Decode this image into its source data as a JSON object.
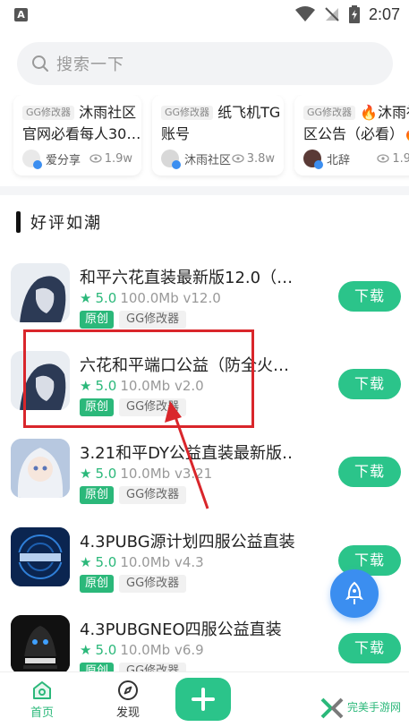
{
  "status_bar": {
    "time": "2:07",
    "app_indicator": "A"
  },
  "search": {
    "placeholder": "搜索一下"
  },
  "cards": [
    {
      "tag": "GG修改器",
      "title": "沐雨社区",
      "title_line2": "官网必看每人30…",
      "author": "爱分享",
      "views": "1.9w"
    },
    {
      "tag": "GG修改器",
      "title": "纸飞机TG",
      "title_line2": "账号",
      "author": "沐雨社区",
      "views": "3.8w"
    },
    {
      "tag": "GG修改器",
      "title": "🔥沐雨社",
      "title_line2": "区公告（必看）🔥",
      "author": "北辞",
      "views": "1.9"
    }
  ],
  "section": {
    "title": "好评如潮"
  },
  "apps": [
    {
      "title": "和平六花直装最新版12.0（…",
      "rating": "5.0",
      "meta": "100.0Mb v12.0",
      "tag_original": "原创",
      "tag_category": "GG修改器",
      "button": "下载"
    },
    {
      "title": "六花和平端口公益（防全火…",
      "rating": "5.0",
      "meta": "10.0Mb v2.0",
      "tag_original": "原创",
      "tag_category": "GG修改器",
      "button": "下载"
    },
    {
      "title": "3.21和平DY公益直装最新版…",
      "rating": "5.0",
      "meta": "10.0Mb v3.21",
      "tag_original": "原创",
      "tag_category": "GG修改器",
      "button": "下载"
    },
    {
      "title": "4.3PUBG源计划四服公益直装",
      "rating": "5.0",
      "meta": "10.0Mb v4.3",
      "tag_original": "原创",
      "tag_category": "GG修改器",
      "button": "下载"
    },
    {
      "title": "4.3PUBGNEO四服公益直装",
      "rating": "5.0",
      "meta": "10.0Mb v6.9",
      "tag_original": "原创",
      "tag_category": "GG修改器",
      "button": "下载"
    }
  ],
  "bottom_nav": {
    "home": "首页",
    "discover": "发现"
  },
  "watermark": {
    "text": "完美手游网"
  },
  "colors": {
    "accent": "#2bc48a",
    "annotation": "#d9262b",
    "fab": "#3b8ef0"
  }
}
